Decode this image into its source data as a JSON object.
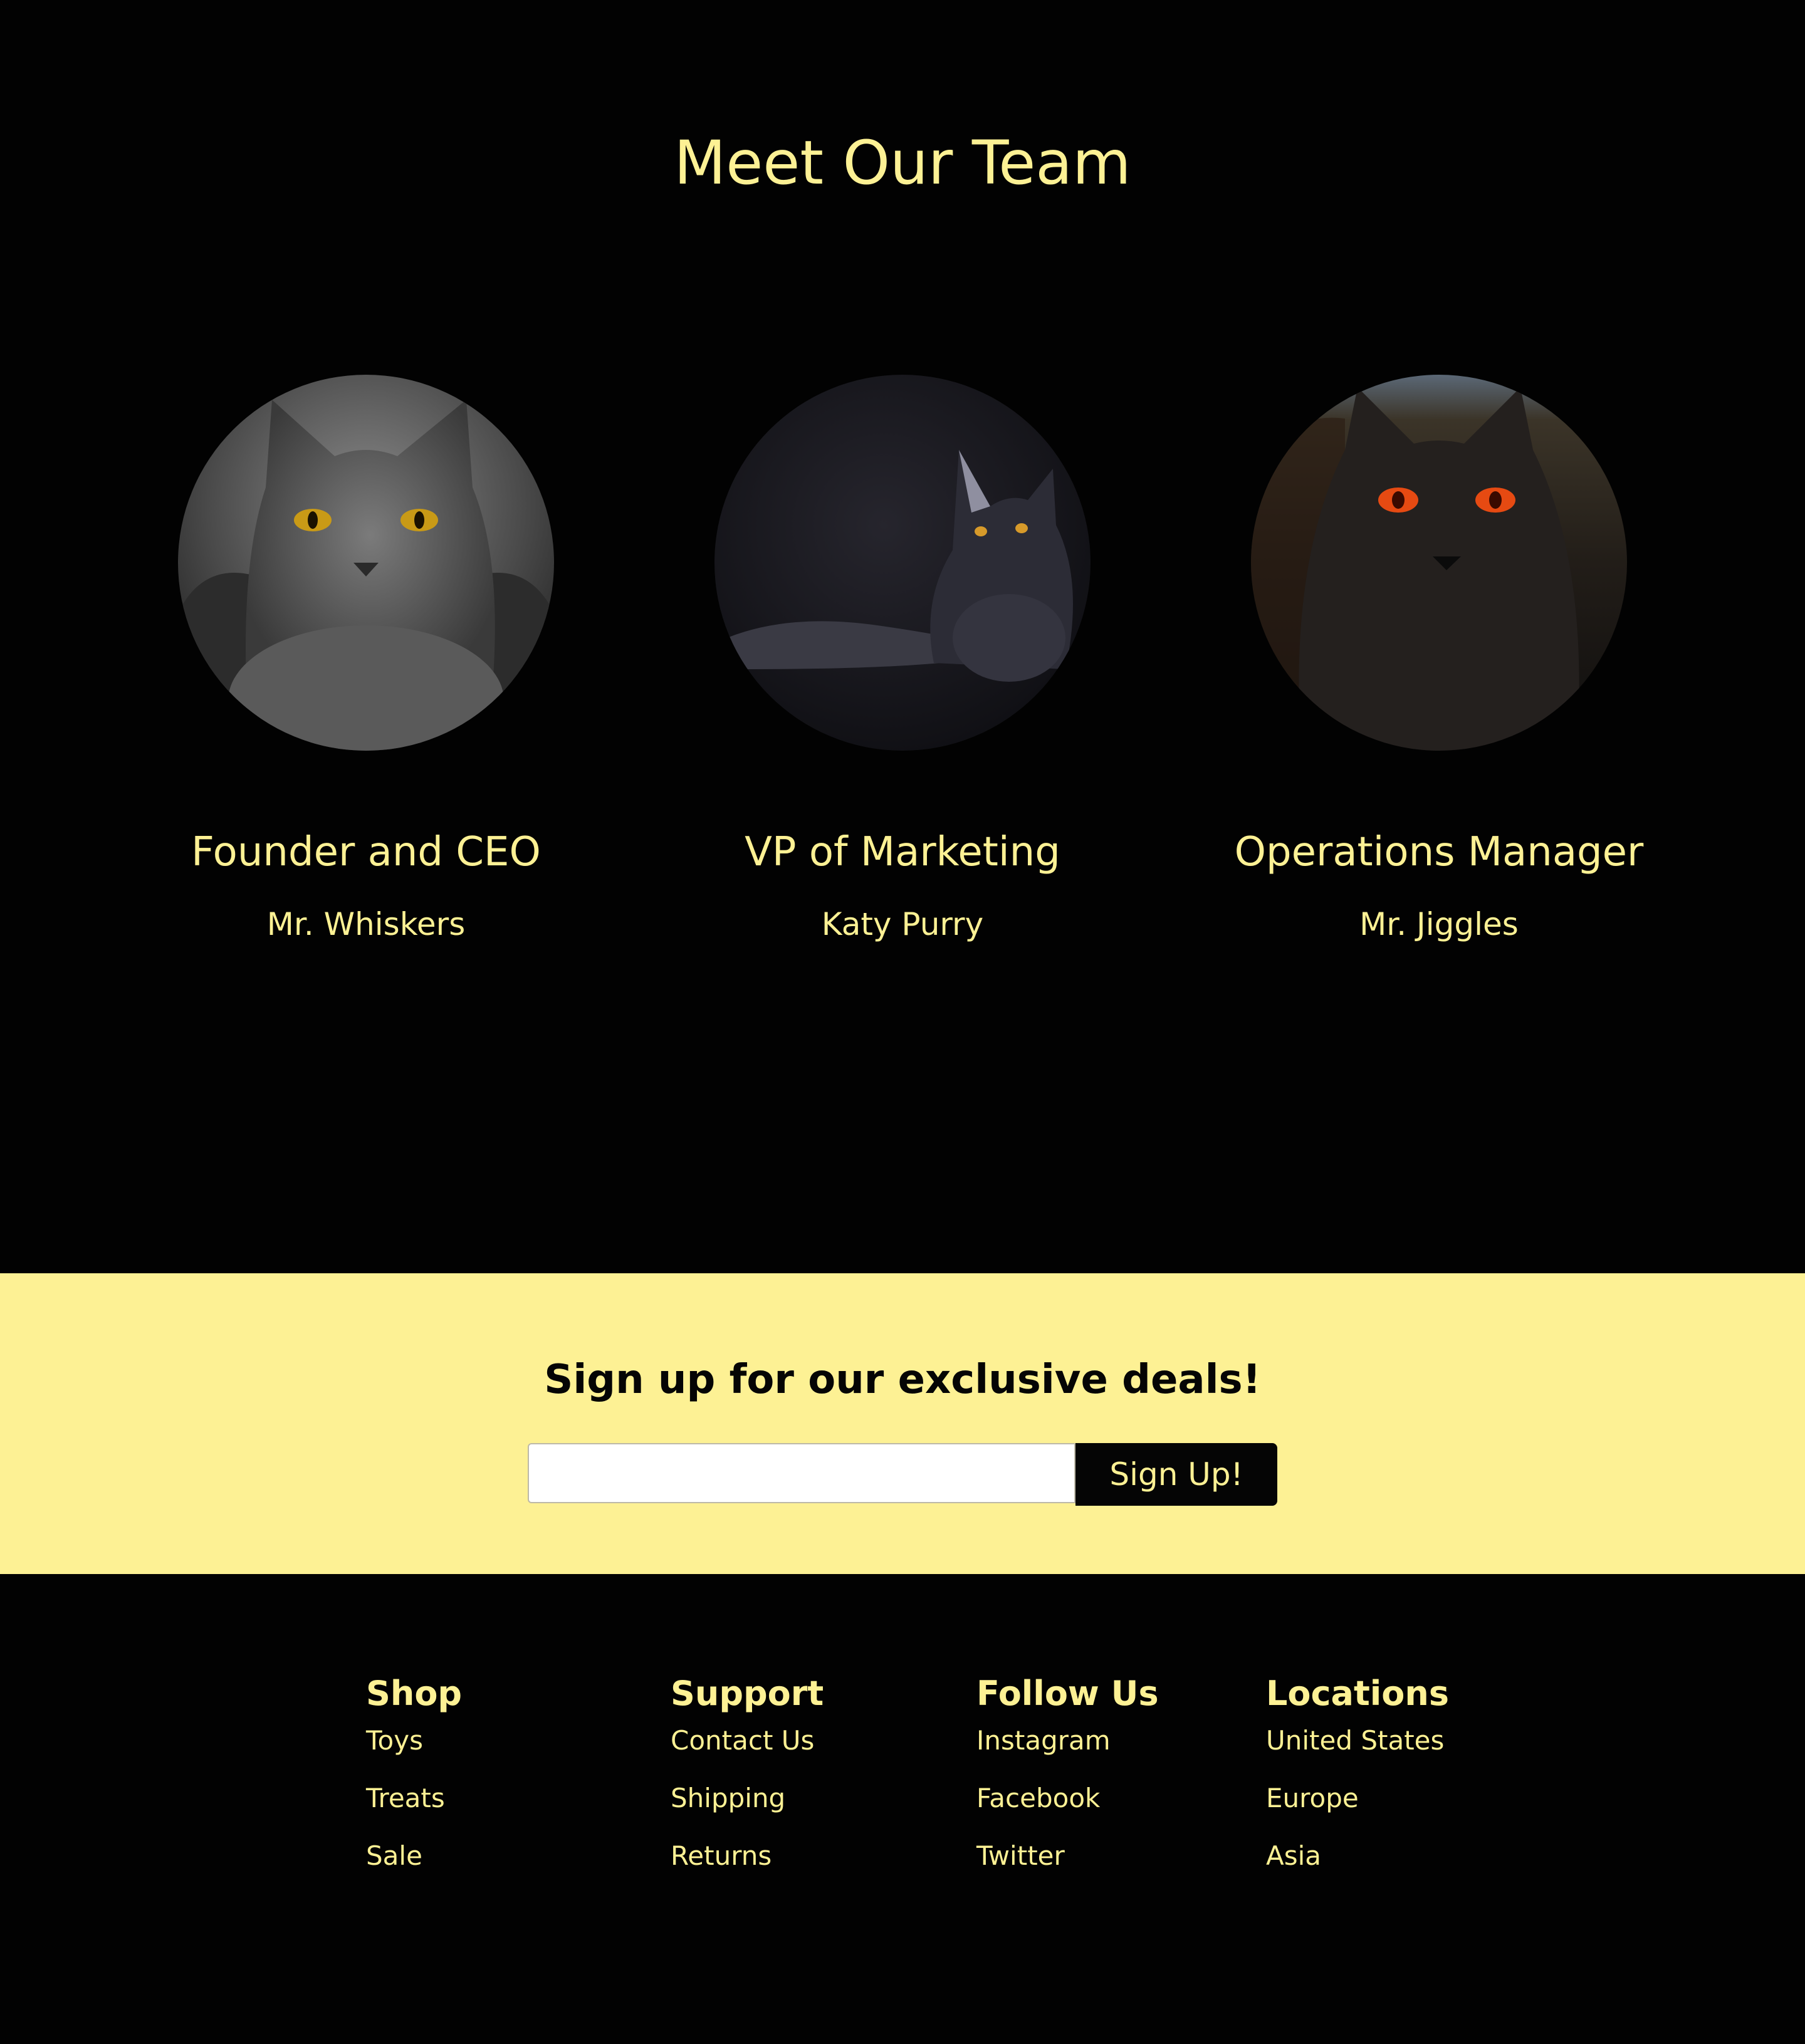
{
  "team": {
    "title": "Meet Our Team",
    "members": [
      {
        "role": "Founder and CEO",
        "name": "Mr. Whiskers"
      },
      {
        "role": "VP of Marketing",
        "name": "Katy Purry"
      },
      {
        "role": "Operations Manager",
        "name": "Mr. Jiggles"
      }
    ]
  },
  "signup": {
    "title": "Sign up for our exclusive deals!",
    "email_value": "",
    "email_placeholder": "",
    "button_label": "Sign Up!"
  },
  "footer": {
    "columns": [
      {
        "heading": "Shop",
        "links": [
          "Toys",
          "Treats",
          "Sale"
        ]
      },
      {
        "heading": "Support",
        "links": [
          "Contact Us",
          "Shipping",
          "Returns"
        ]
      },
      {
        "heading": "Follow Us",
        "links": [
          "Instagram",
          "Facebook",
          "Twitter"
        ]
      },
      {
        "heading": "Locations",
        "links": [
          "United States",
          "Europe",
          "Asia"
        ]
      }
    ]
  },
  "colors": {
    "background": "#020202",
    "accent": "#fdf194",
    "dark_text": "#050505"
  }
}
